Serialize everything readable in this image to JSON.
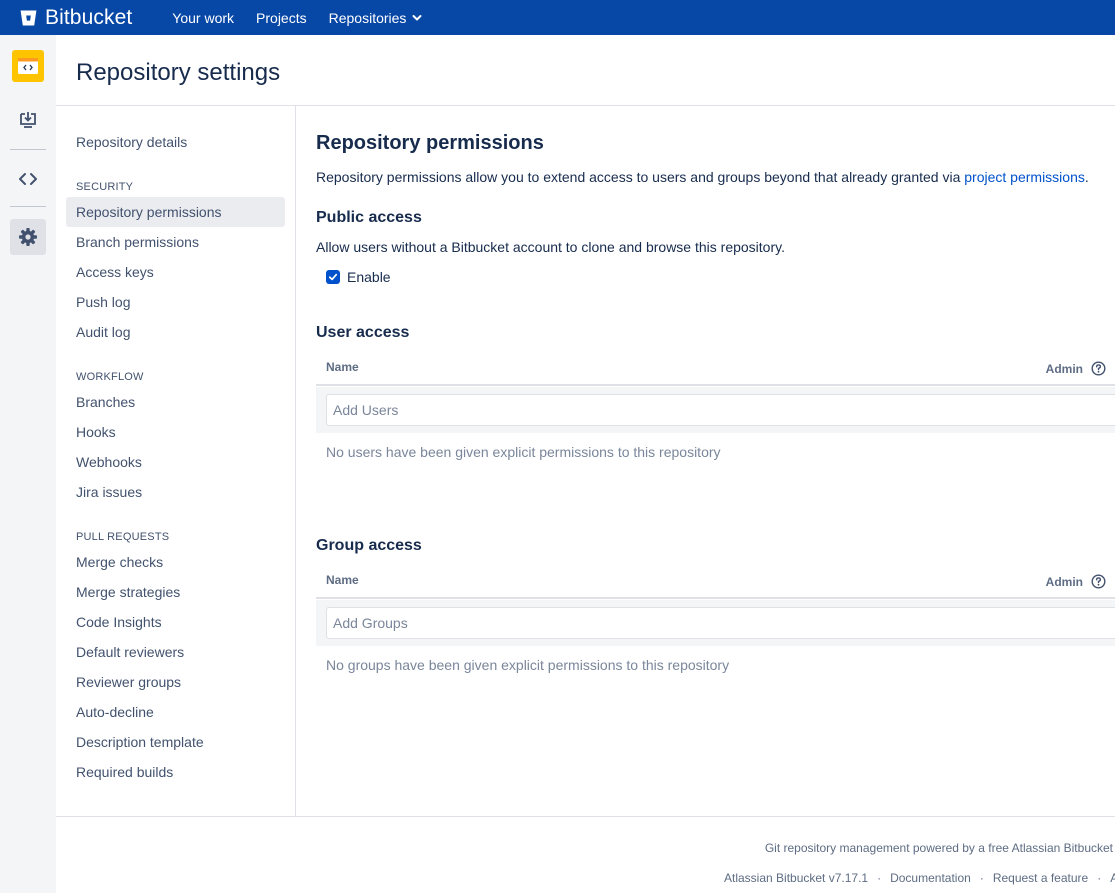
{
  "topnav": {
    "brand": "Bitbucket",
    "links": [
      "Your work",
      "Projects",
      "Repositories"
    ]
  },
  "header": {
    "title": "Repository settings"
  },
  "settings_nav": {
    "repo_details": "Repository details",
    "security_heading": "SECURITY",
    "security_items": [
      "Repository permissions",
      "Branch permissions",
      "Access keys",
      "Push log",
      "Audit log"
    ],
    "workflow_heading": "WORKFLOW",
    "workflow_items": [
      "Branches",
      "Hooks",
      "Webhooks",
      "Jira issues"
    ],
    "pr_heading": "PULL REQUESTS",
    "pr_items": [
      "Merge checks",
      "Merge strategies",
      "Code Insights",
      "Default reviewers",
      "Reviewer groups",
      "Auto-decline",
      "Description template",
      "Required builds"
    ]
  },
  "main": {
    "title": "Repository permissions",
    "intro_text": "Repository permissions allow you to extend access to users and groups beyond that already granted via ",
    "intro_link": "project permissions",
    "intro_end": ".",
    "public_access": {
      "title": "Public access",
      "description": "Allow users without a Bitbucket account to clone and browse this repository.",
      "checkbox_label": "Enable",
      "checked": true
    },
    "user_access": {
      "title": "User access",
      "col_name": "Name",
      "col_admin": "Admin",
      "placeholder": "Add Users",
      "empty": "No users have been given explicit permissions to this repository"
    },
    "group_access": {
      "title": "Group access",
      "col_name": "Name",
      "col_admin": "Admin",
      "placeholder": "Add Groups",
      "empty": "No groups have been given explicit permissions to this repository"
    }
  },
  "footer": {
    "line1": "Git repository management powered by a free Atlassian Bitbucket",
    "version": "Atlassian Bitbucket v7.17.1",
    "documentation": "Documentation",
    "request_feature": "Request a feature",
    "truncated": "A",
    "separator": "·"
  },
  "colors": {
    "nav_bg": "#0747a6",
    "link": "#0052cc",
    "repo_icon_bg": "#ffc400",
    "sidebar_bg": "#f4f5f7"
  },
  "icons": [
    "bitbucket-logo-icon",
    "chevron-down-icon",
    "repository-icon",
    "clone-icon",
    "source-code-icon",
    "settings-gear-icon",
    "help-icon",
    "checkmark-icon"
  ]
}
